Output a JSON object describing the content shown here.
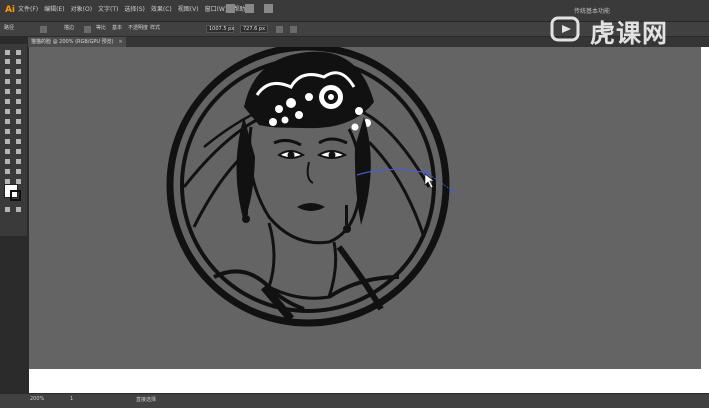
{
  "app": {
    "logo": "Ai"
  },
  "menu": {
    "items": [
      "文件(F)",
      "编辑(E)",
      "对象(O)",
      "文字(T)",
      "选择(S)",
      "效果(C)",
      "视图(V)",
      "窗口(W)",
      "帮助(H)"
    ]
  },
  "workspace": {
    "label": "传统基本功能"
  },
  "controlbar": {
    "selection_label": "路径",
    "stroke_label": "描边",
    "stroke_value": "",
    "uniform_label": "等比",
    "basic_label": "基本",
    "opacity_label": "不透明度",
    "style_label": "样式",
    "x_value": "1007.5 px",
    "y_value": "727.6 px"
  },
  "document": {
    "tab_title": "猫猫的脸 @ 200% (RGB/GPU 预览)"
  },
  "status": {
    "zoom": "200%",
    "page": "1",
    "tool": "直接选择"
  },
  "watermark": {
    "text": "虎课网"
  },
  "colors": {
    "canvas": "#646464",
    "artwork": "#111111",
    "accent": "#ff9a00",
    "path_highlight": "#4a5bd0"
  },
  "icons": {
    "toolbox": [
      "selection-icon",
      "direct-selection-icon",
      "magic-wand-icon",
      "lasso-icon",
      "pen-icon",
      "curvature-icon",
      "type-icon",
      "line-icon",
      "rectangle-icon",
      "paintbrush-icon",
      "pencil-icon",
      "eraser-icon",
      "rotate-icon",
      "scale-icon",
      "width-icon",
      "free-transform-icon",
      "shape-builder-icon",
      "perspective-icon",
      "mesh-icon",
      "gradient-icon",
      "eyedropper-icon",
      "blend-icon",
      "symbol-sprayer-icon",
      "graph-icon",
      "artboard-icon",
      "slice-icon",
      "hand-icon",
      "zoom-icon"
    ]
  }
}
